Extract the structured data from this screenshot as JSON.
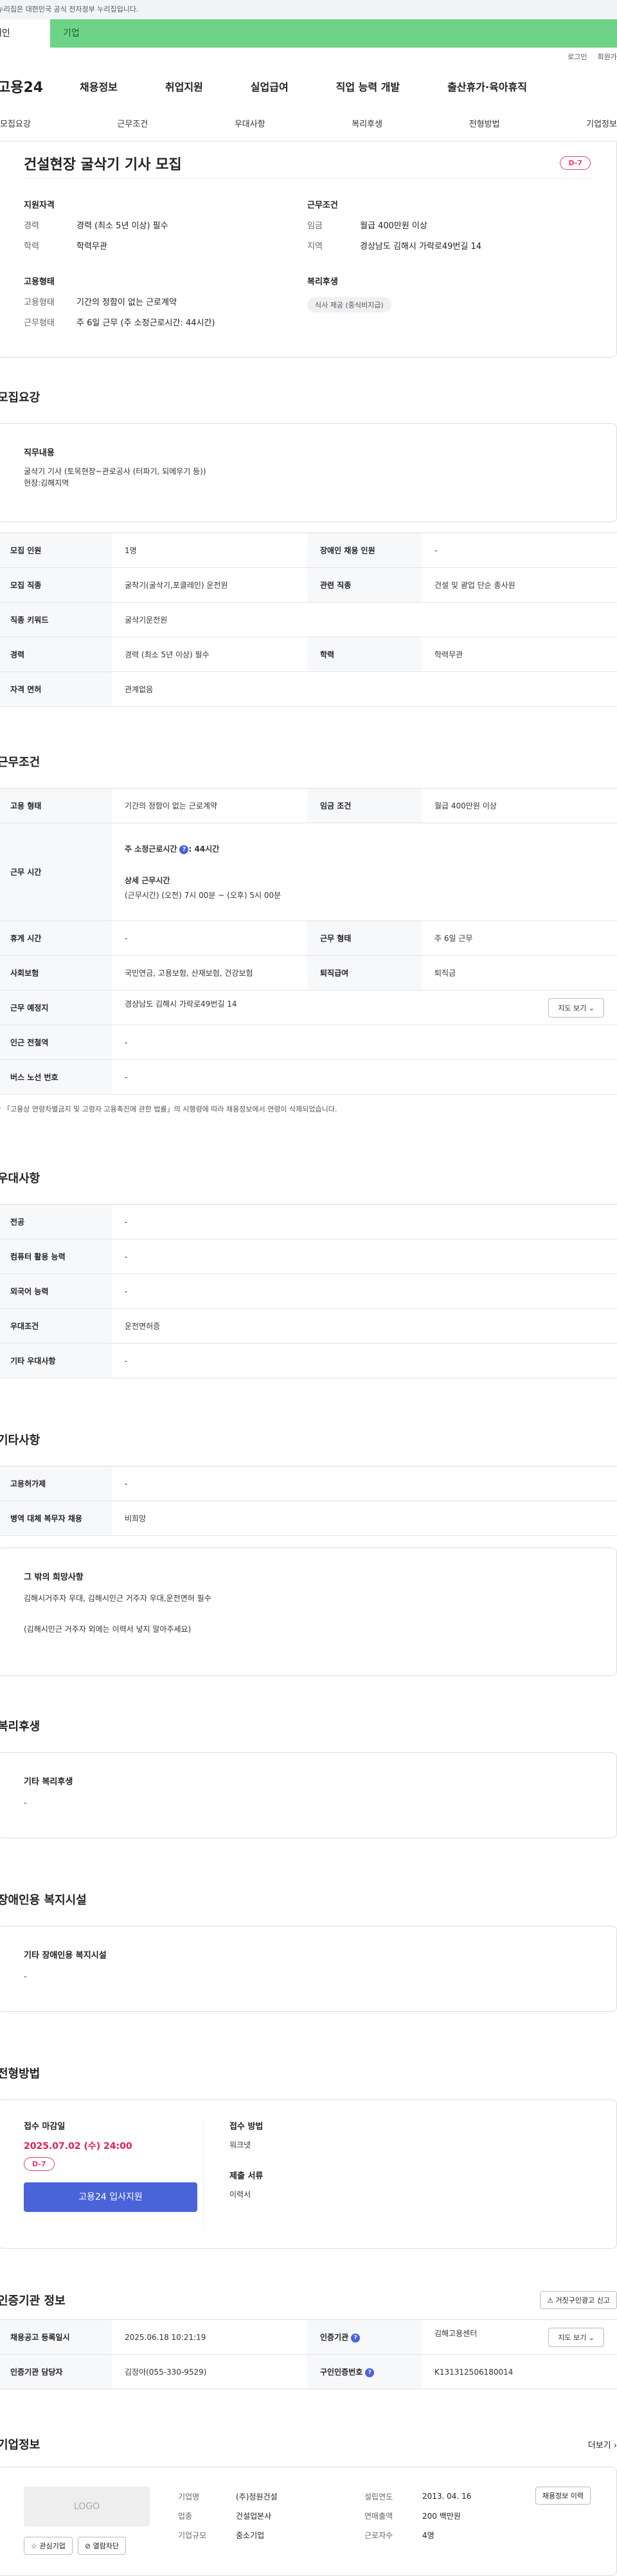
{
  "gov_banner": "이 누리집은 대한민국 공식 전자정부 누리집입니다.",
  "top_tabs": [
    "개인",
    "기업"
  ],
  "util": [
    "로그인",
    "회원가입"
  ],
  "logo": "고용24",
  "gnb": [
    "채용정보",
    "취업지원",
    "실업급여",
    "직업 능력 개발",
    "출산휴가·육아휴직"
  ],
  "snb": [
    "모집요강",
    "근무조건",
    "우대사항",
    "복리후생",
    "전형방법",
    "기업정보"
  ],
  "header": {
    "title": "건설현장 굴삭기 기사 모집",
    "dday": "D-7",
    "qual_title": "지원자격",
    "qual": [
      {
        "k": "경력",
        "v": "경력 (최소 5년 이상) 필수"
      },
      {
        "k": "학력",
        "v": "학력무관"
      }
    ],
    "emp_title": "고용형태",
    "emp": [
      {
        "k": "고용형태",
        "v": "기간의 정함이 없는 근로계약"
      },
      {
        "k": "근무형태",
        "v": "주 6일 근무 (주 소정근로시간: 44시간)"
      }
    ],
    "cond_title": "근무조건",
    "cond": [
      {
        "k": "임금",
        "v": "월급 400만원 이상"
      },
      {
        "k": "지역",
        "v": "경상남도 김해시 가락로49번길 14"
      }
    ],
    "welfare_title": "복리후생",
    "welfare_chip": "식사 제공 (중식비지급)"
  },
  "recruit": {
    "title": "모집요강",
    "duty_label": "직무내용",
    "duty_text": [
      "굴삭기 기사 (토목현장~관로공사 (터파기, 되메우기 등))",
      "현장:김해지역"
    ],
    "rows": [
      [
        "모집 인원",
        "1명",
        "장애인 채용 인원",
        "-"
      ],
      [
        "모집 직종",
        "굴착기(굴삭기,포클레인) 운전원",
        "관련 직종",
        "건설 및 광업 단순 종사원"
      ],
      [
        "직종 키워드",
        "굴삭기운전원"
      ],
      [
        "경력",
        "경력 (최소 5년 이상) 필수",
        "학력",
        "학력무관"
      ],
      [
        "자격 면허",
        "관계없음"
      ]
    ]
  },
  "work": {
    "title": "근무조건",
    "r1": [
      "고용 형태",
      "기간의 정함이 없는 근로계약",
      "임금 조건",
      "월급 400만원 이상"
    ],
    "hours_label": "근무 시간",
    "hours_week": "주 소정근로시간",
    "hours_week_val": ": 44시간",
    "hours_detail_label": "상세 근무시간",
    "hours_detail": "(근무시간) (오전) 7시 00분 ~ (오후) 5시 00분",
    "r3": [
      "휴게 시간",
      "-",
      "근무 형태",
      "주 6일 근무"
    ],
    "r4": [
      "사회보험",
      "국민연금, 고용보험, 산재보험, 건강보험",
      "퇴직급여",
      "퇴직금"
    ],
    "r5": [
      "근무 예정지",
      "경상남도 김해시 가락로49번길 14"
    ],
    "map_btn": "지도 보기",
    "r6": [
      "인근 전철역",
      "-"
    ],
    "r7": [
      "버스 노선 번호",
      "-"
    ],
    "note": "* 「고용상 연령차별금지 및 고령자 고용촉진에 관한 법률」의 시행령에 따라 채용정보에서 연령이 삭제되었습니다."
  },
  "pref": {
    "title": "우대사항",
    "rows": [
      [
        "전공",
        "-"
      ],
      [
        "컴퓨터 활용 능력",
        "-"
      ],
      [
        "외국어 능력",
        "-"
      ],
      [
        "우대조건",
        "운전면허증"
      ],
      [
        "기타 우대사항",
        "-"
      ]
    ]
  },
  "etc": {
    "title": "기타사항",
    "rows": [
      [
        "고용허가제",
        "-"
      ],
      [
        "병역 대체 복무자 채용",
        "비희망"
      ]
    ],
    "other_label": "그 밖의 희망사항",
    "other_lines": [
      "김해시거주자 우대, 김해시인근 거주자 우대,운전면허 필수",
      "(김해시인근 거주자 외에는 이력서 넣지 말아주세요)"
    ]
  },
  "benefit": {
    "title": "복리후생",
    "label": "기타 복리후생",
    "value": "-"
  },
  "disabled": {
    "title": "장애인용 복지시설",
    "label": "기타 장애인용 복지시설",
    "value": "-"
  },
  "selection": {
    "title": "전형방법",
    "deadline_label": "접수 마감일",
    "deadline": "2025.07.02 (수) 24:00",
    "dday": "D-7",
    "apply": "고용24 입사지원",
    "method_label": "접수 방법",
    "method": "워크넷",
    "docs_label": "제출 서류",
    "docs": "이력서"
  },
  "agency": {
    "title": "인증기관 정보",
    "report_btn": "거짓구인광고 신고",
    "rows": [
      [
        "채용공고 등록일시",
        "2025.06.18 10:21:19",
        "인증기관",
        "김해고용센터"
      ],
      [
        "인증기관 담당자",
        "김정아(055-330-9529)",
        "구인인증번호",
        "K131312506180014"
      ]
    ],
    "map_btn": "지도 보기"
  },
  "company": {
    "title": "기업정보",
    "more": "더보기",
    "logo": "LOGO",
    "fav": "관심기업",
    "block": "열람차단",
    "info": [
      [
        "기업명",
        "(주)정원건설",
        "설립연도",
        "2013. 04. 16"
      ],
      [
        "업종",
        "건설업본사",
        "연매출액",
        "200 백만원"
      ],
      [
        "기업규모",
        "중소기업",
        "근로자수",
        "4명"
      ]
    ],
    "history_btn": "채용정보 이력"
  }
}
